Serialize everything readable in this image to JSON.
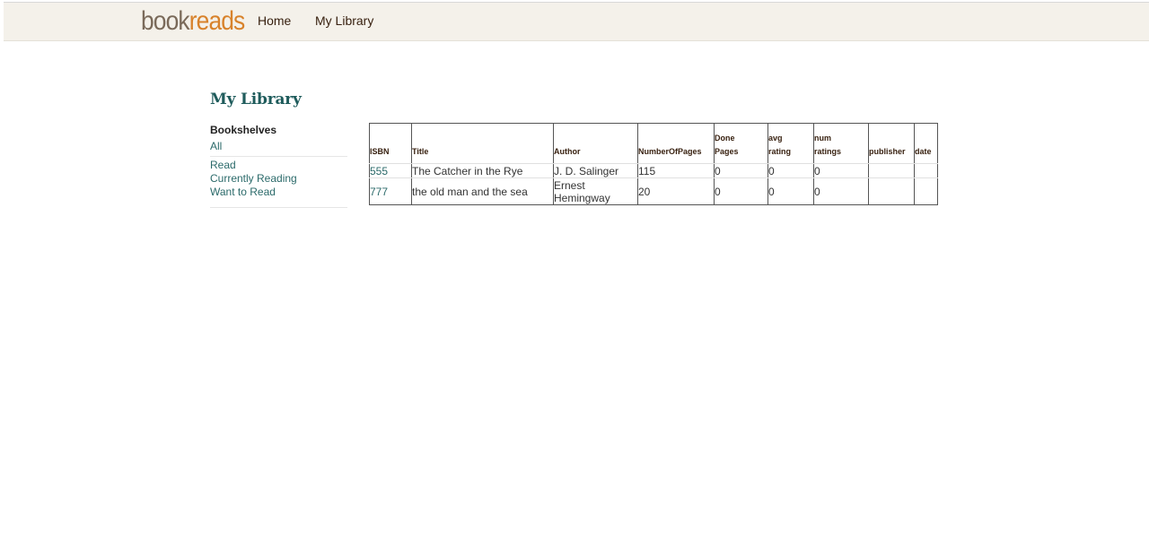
{
  "header": {
    "logo_book": "book",
    "logo_reads": "reads",
    "nav": [
      {
        "label": "Home"
      },
      {
        "label": "My Library"
      }
    ]
  },
  "page": {
    "title": "My Library"
  },
  "sidebar": {
    "heading": "Bookshelves",
    "all_label": "All",
    "shelves": [
      {
        "label": "Read"
      },
      {
        "label": "Currently Reading"
      },
      {
        "label": "Want to Read"
      }
    ]
  },
  "table": {
    "headers": {
      "isbn": "ISBN",
      "title": "Title",
      "author": "Author",
      "pages": "NumberOfPages",
      "done_line1": "Done",
      "done_line2": "Pages",
      "avg_line1": "avg",
      "avg_line2": "rating",
      "num_line1": "num",
      "num_line2": "ratings",
      "publisher": "publisher",
      "date": "date"
    },
    "rows": [
      {
        "isbn": "555",
        "title": "The Catcher in the Rye",
        "author": "J. D. Salinger",
        "pages": "115",
        "done_pages": "0",
        "avg_rating": "0",
        "num_ratings": "0",
        "publisher": "",
        "date": ""
      },
      {
        "isbn": "777",
        "title": "the old man and the sea",
        "author": "Ernest Hemingway",
        "pages": "20",
        "done_pages": "0",
        "avg_rating": "0",
        "num_ratings": "0",
        "publisher": "",
        "date": ""
      }
    ]
  }
}
